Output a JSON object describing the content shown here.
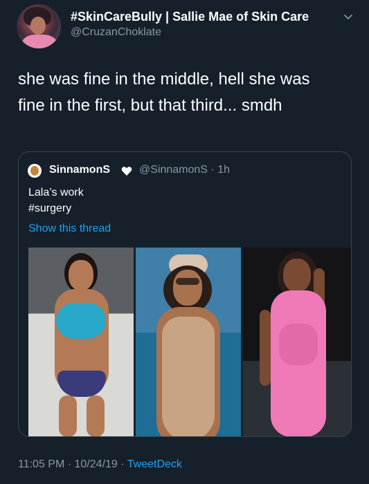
{
  "tweet": {
    "display_name": "#SkinCareBully | Sallie Mae of Skin Care",
    "handle": "@CruzanChoklate",
    "text_line1": "she was fine in the middle, hell she was",
    "text_line2": "fine in the first, but that third... smdh",
    "time": "11:05 PM",
    "date": "10/24/19",
    "separator": "·",
    "source": "TweetDeck"
  },
  "quoted": {
    "name": "SinnamonS",
    "handle_time": "@SinnamonS · 1h",
    "line1": "Lala’s work",
    "line2": "#surgery",
    "thread_link": "Show this thread"
  },
  "colors": {
    "background": "#15202b",
    "secondary_text": "#8899a6",
    "link": "#1da1f2",
    "border": "#38444d"
  }
}
